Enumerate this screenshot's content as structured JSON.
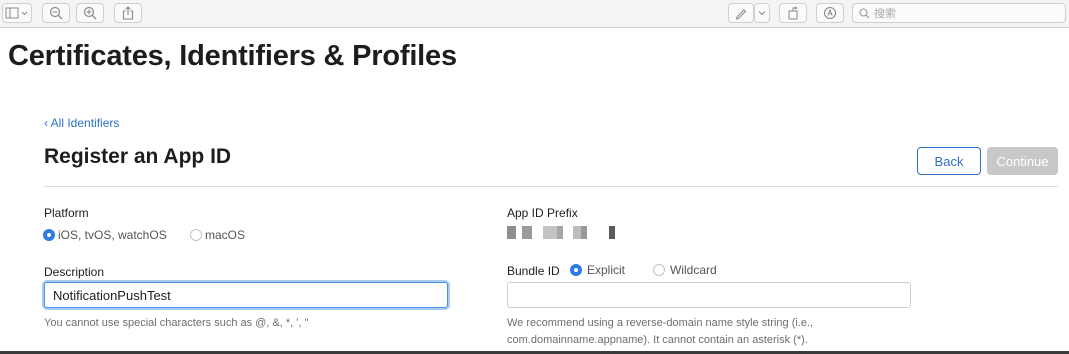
{
  "toolbar": {
    "search_placeholder": "搜索"
  },
  "page": {
    "title": "Certificates, Identifiers & Profiles",
    "back_link": "‹ All Identifiers",
    "section_title": "Register an App ID",
    "back_button": "Back",
    "continue_button": "Continue"
  },
  "platform": {
    "label": "Platform",
    "options": [
      {
        "label": "iOS, tvOS, watchOS",
        "selected": true
      },
      {
        "label": "macOS",
        "selected": false
      }
    ]
  },
  "app_id_prefix": {
    "label": "App ID Prefix"
  },
  "description": {
    "label": "Description",
    "value": "NotificationPushTest",
    "hint": "You cannot use special characters such as @, &, *, ', \""
  },
  "bundle_id": {
    "label": "Bundle ID",
    "options": [
      {
        "label": "Explicit",
        "selected": true
      },
      {
        "label": "Wildcard",
        "selected": false
      }
    ],
    "value": "",
    "hint_line1": "We recommend using a reverse-domain name style string (i.e.,",
    "hint_line2": "com.domainname.appname). It cannot contain an asterisk (*)."
  },
  "colors": {
    "accent": "#2f7ae5",
    "link": "#2f6fc6",
    "disabled_button": "#c8c8c8"
  }
}
